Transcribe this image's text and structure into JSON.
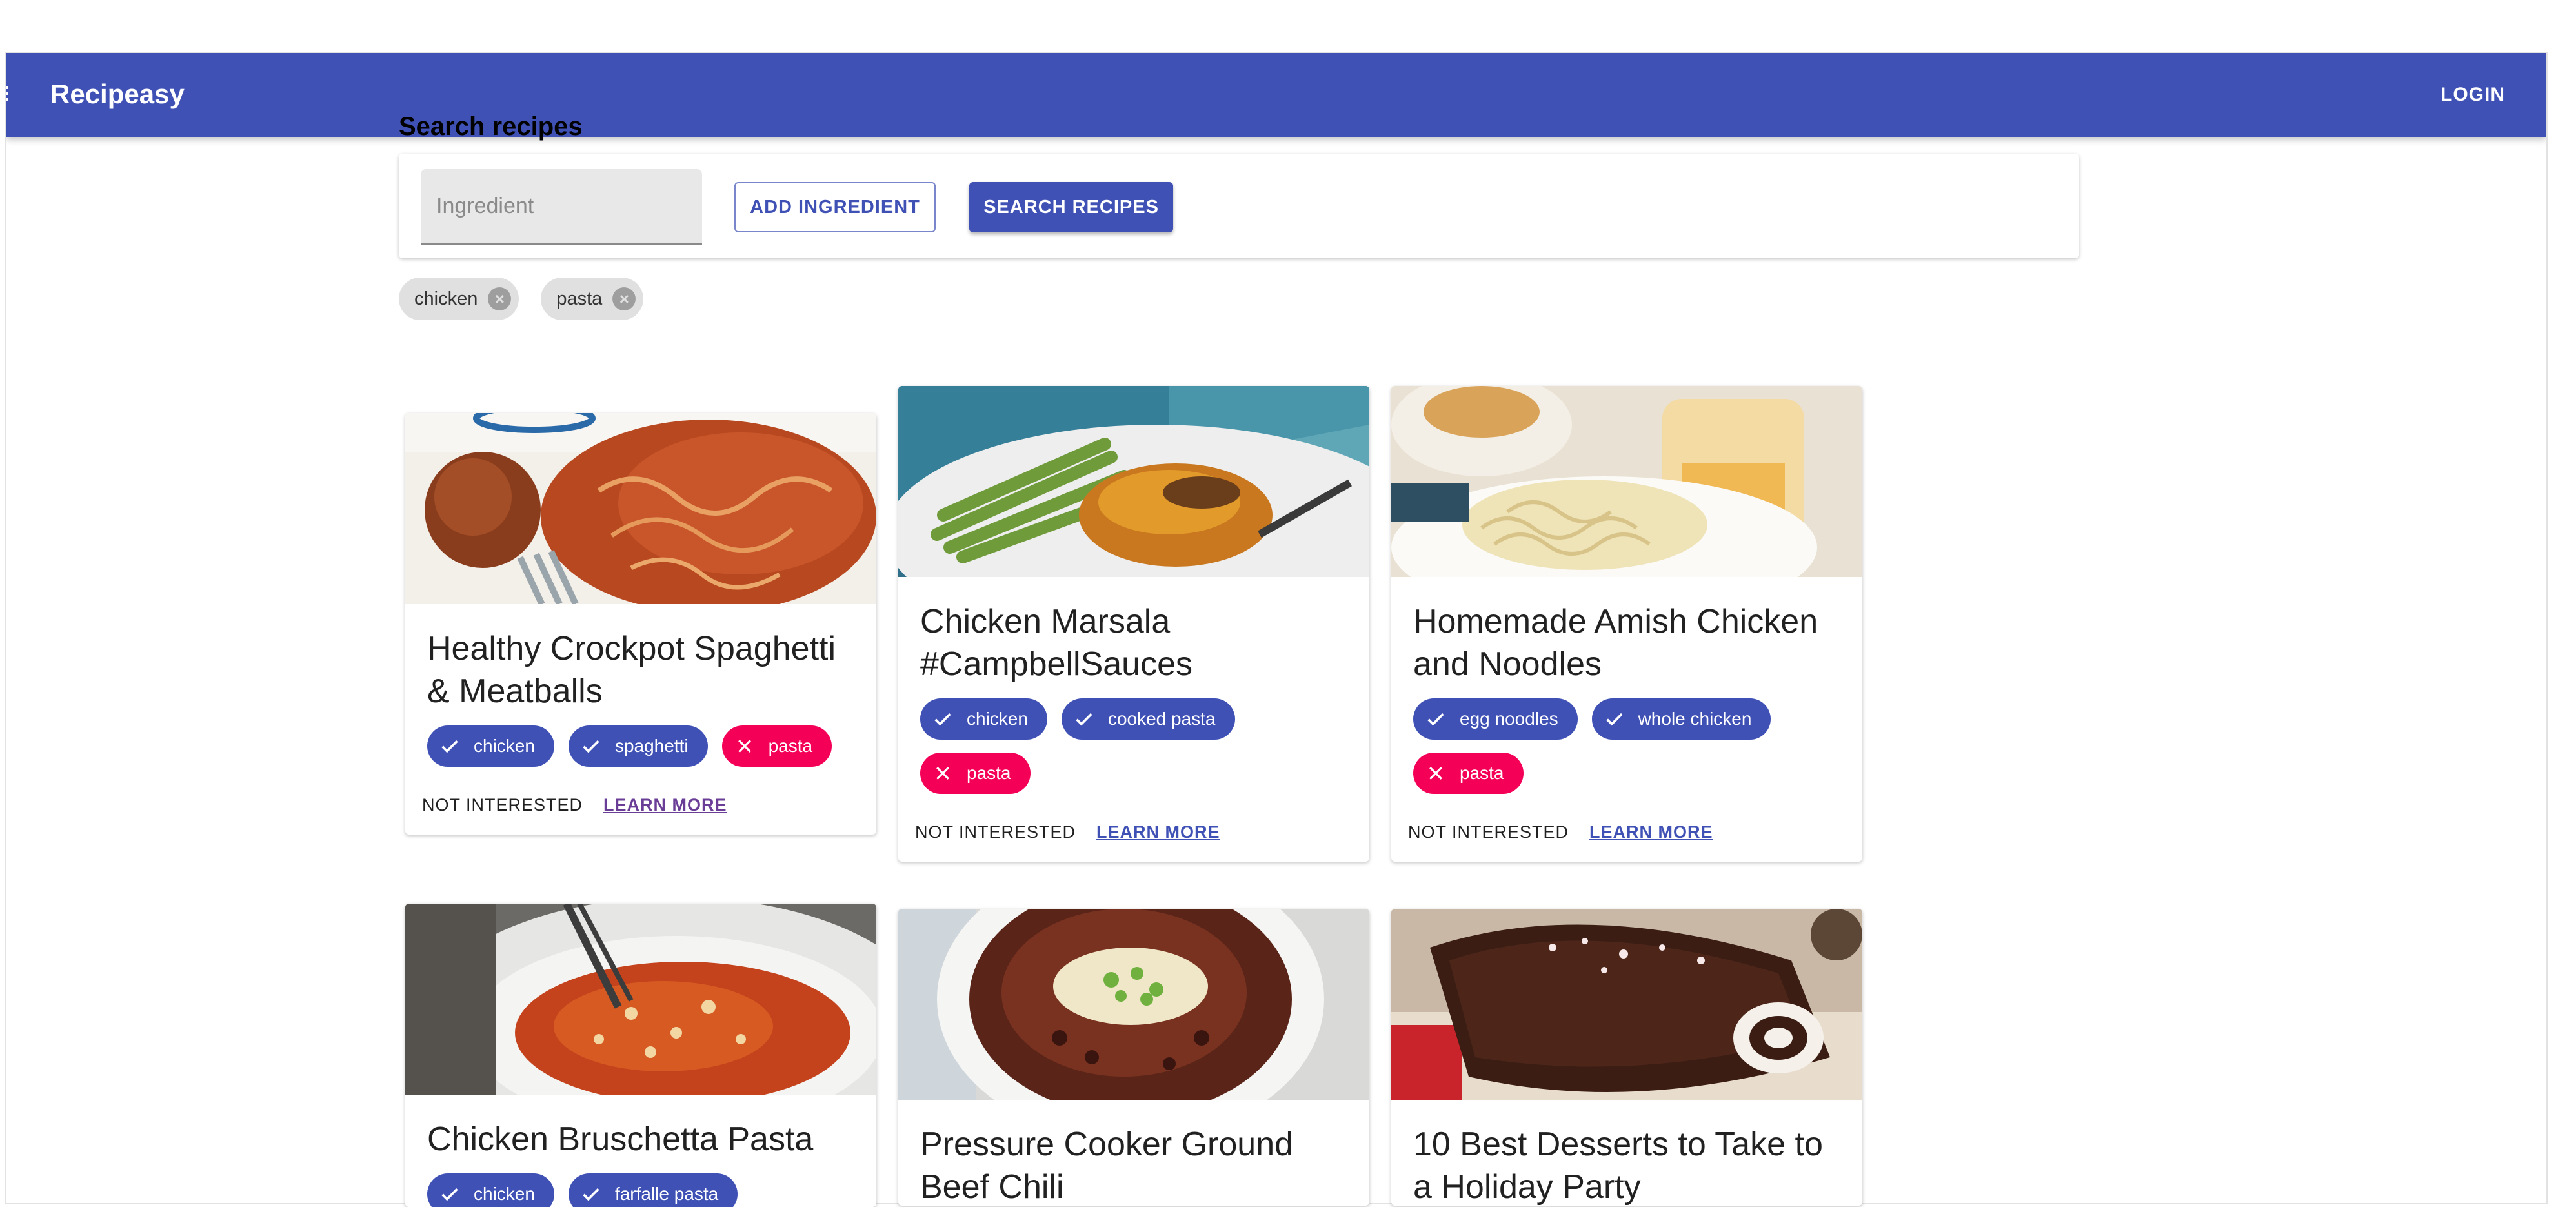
{
  "app": {
    "title": "Recipeasy",
    "login_label": "LOGIN"
  },
  "search": {
    "heading": "Search recipes",
    "input_placeholder": "Ingredient",
    "add_label": "ADD INGREDIENT",
    "search_label": "SEARCH RECIPES"
  },
  "filters": [
    {
      "label": "chicken"
    },
    {
      "label": "pasta"
    }
  ],
  "cards": [
    {
      "title": "Healthy Crockpot Spaghetti & Meatballs",
      "tags": [
        {
          "label": "chicken",
          "status": "have"
        },
        {
          "label": "spaghetti",
          "status": "have"
        },
        {
          "label": "pasta",
          "status": "missing"
        }
      ],
      "not_interested_label": "NOT INTERESTED",
      "learn_more_label": "LEARN MORE"
    },
    {
      "title": "Chicken Marsala #CampbellSauces",
      "tags": [
        {
          "label": "chicken",
          "status": "have"
        },
        {
          "label": "cooked pasta",
          "status": "have"
        },
        {
          "label": "pasta",
          "status": "missing"
        }
      ],
      "not_interested_label": "NOT INTERESTED",
      "learn_more_label": "LEARN MORE"
    },
    {
      "title": "Homemade Amish Chicken and Noodles",
      "tags": [
        {
          "label": "egg noodles",
          "status": "have"
        },
        {
          "label": "whole chicken",
          "status": "have"
        },
        {
          "label": "pasta",
          "status": "missing"
        }
      ],
      "not_interested_label": "NOT INTERESTED",
      "learn_more_label": "LEARN MORE"
    },
    {
      "title": "Chicken Bruschetta Pasta",
      "tags": [
        {
          "label": "chicken",
          "status": "have"
        },
        {
          "label": "farfalle pasta",
          "status": "have"
        }
      ]
    },
    {
      "title": "Pressure Cooker Ground Beef Chili",
      "tags": []
    },
    {
      "title": "10 Best Desserts to Take to a Holiday Party",
      "tags": []
    }
  ],
  "icons": {
    "check": "check-icon",
    "cancel": "close-icon",
    "chip_delete": "cancel-circle-icon",
    "menu": "menu-icon"
  },
  "colors": {
    "primary": "#3f51b5",
    "secondary": "#f50057",
    "chip_bg": "#e0e0e0"
  }
}
